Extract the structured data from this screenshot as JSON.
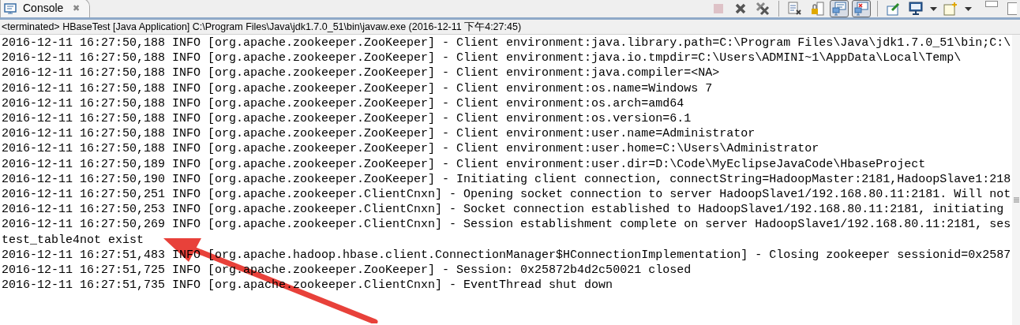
{
  "tab": {
    "title": "Console",
    "close": "✖"
  },
  "toolbar": [
    {
      "kind": "stop",
      "disabled": true,
      "selected": false
    },
    {
      "kind": "remove",
      "disabled": false,
      "selected": false
    },
    {
      "kind": "remove-all",
      "disabled": false,
      "selected": false
    },
    {
      "kind": "sep"
    },
    {
      "kind": "clear",
      "disabled": false,
      "selected": false
    },
    {
      "kind": "lock",
      "disabled": false,
      "selected": false
    },
    {
      "kind": "show-out",
      "disabled": false,
      "selected": true
    },
    {
      "kind": "show-err",
      "disabled": false,
      "selected": true
    },
    {
      "kind": "sep"
    },
    {
      "kind": "pin",
      "disabled": false,
      "selected": false
    },
    {
      "kind": "display",
      "disabled": false,
      "selected": false
    },
    {
      "kind": "caret"
    },
    {
      "kind": "new",
      "disabled": false,
      "selected": false
    },
    {
      "kind": "caret"
    },
    {
      "kind": "minimize"
    },
    {
      "kind": "maximize"
    }
  ],
  "status": "<terminated> HBaseTest [Java Application] C:\\Program Files\\Java\\jdk1.7.0_51\\bin\\javaw.exe (2016-12-11 下午4:27:45)",
  "lines": [
    "2016-12-11 16:27:50,188 INFO [org.apache.zookeeper.ZooKeeper] - Client environment:java.library.path=C:\\Program Files\\Java\\jdk1.7.0_51\\bin;C:\\",
    "2016-12-11 16:27:50,188 INFO [org.apache.zookeeper.ZooKeeper] - Client environment:java.io.tmpdir=C:\\Users\\ADMINI~1\\AppData\\Local\\Temp\\",
    "2016-12-11 16:27:50,188 INFO [org.apache.zookeeper.ZooKeeper] - Client environment:java.compiler=<NA>",
    "2016-12-11 16:27:50,188 INFO [org.apache.zookeeper.ZooKeeper] - Client environment:os.name=Windows 7",
    "2016-12-11 16:27:50,188 INFO [org.apache.zookeeper.ZooKeeper] - Client environment:os.arch=amd64",
    "2016-12-11 16:27:50,188 INFO [org.apache.zookeeper.ZooKeeper] - Client environment:os.version=6.1",
    "2016-12-11 16:27:50,188 INFO [org.apache.zookeeper.ZooKeeper] - Client environment:user.name=Administrator",
    "2016-12-11 16:27:50,188 INFO [org.apache.zookeeper.ZooKeeper] - Client environment:user.home=C:\\Users\\Administrator",
    "2016-12-11 16:27:50,189 INFO [org.apache.zookeeper.ZooKeeper] - Client environment:user.dir=D:\\Code\\MyEclipseJavaCode\\HbaseProject",
    "2016-12-11 16:27:50,190 INFO [org.apache.zookeeper.ZooKeeper] - Initiating client connection, connectString=HadoopMaster:2181,HadoopSlave1:218",
    "2016-12-11 16:27:50,251 INFO [org.apache.zookeeper.ClientCnxn] - Opening socket connection to server HadoopSlave1/192.168.80.11:2181. Will not",
    "2016-12-11 16:27:50,253 INFO [org.apache.zookeeper.ClientCnxn] - Socket connection established to HadoopSlave1/192.168.80.11:2181, initiating",
    "2016-12-11 16:27:50,269 INFO [org.apache.zookeeper.ClientCnxn] - Session establishment complete on server HadoopSlave1/192.168.80.11:2181, ses",
    "test_table4not exist",
    "2016-12-11 16:27:51,483 INFO [org.apache.hadoop.hbase.client.ConnectionManager$HConnectionImplementation] - Closing zookeeper sessionid=0x2587",
    "2016-12-11 16:27:51,725 INFO [org.apache.zookeeper.ZooKeeper] - Session: 0x25872b4d2c50021 closed",
    "2016-12-11 16:27:51,735 INFO [org.apache.zookeeper.ClientCnxn] - EventThread shut down"
  ]
}
